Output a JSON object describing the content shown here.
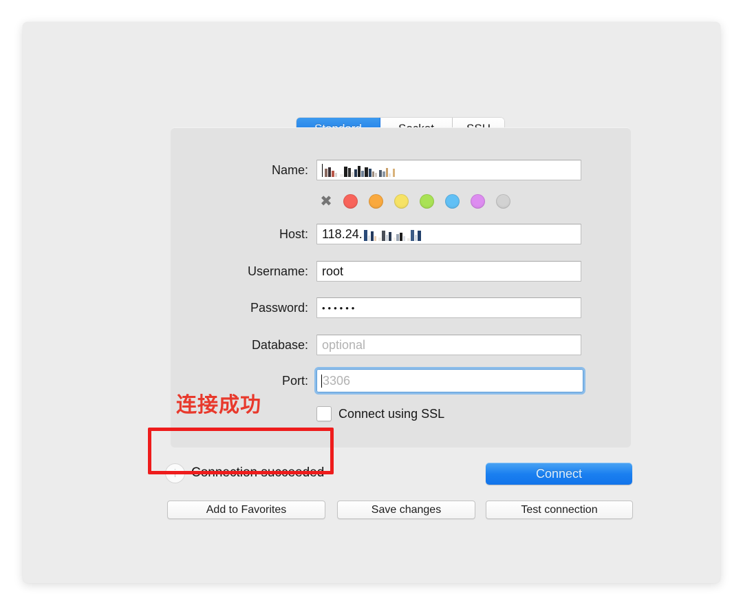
{
  "window": {
    "title": ""
  },
  "tabs": {
    "items": [
      {
        "label": "Standard",
        "active": true
      },
      {
        "label": "Socket",
        "active": false
      },
      {
        "label": "SSH",
        "active": false
      }
    ]
  },
  "form": {
    "fields": [
      {
        "label": "Name:",
        "value": "",
        "placeholder": "",
        "redacted": true,
        "focused": false
      },
      {
        "label": "Host:",
        "value": "118.24.",
        "placeholder": "",
        "redacted": true,
        "focused": false
      },
      {
        "label": "Username:",
        "value": "root",
        "placeholder": "",
        "redacted": false,
        "focused": false
      },
      {
        "label": "Password:",
        "value": "••••••",
        "placeholder": "",
        "redacted": false,
        "focused": false
      },
      {
        "label": "Database:",
        "value": "",
        "placeholder": "optional",
        "redacted": false,
        "focused": false
      },
      {
        "label": "Port:",
        "value": "",
        "placeholder": "3306",
        "redacted": false,
        "focused": true
      }
    ],
    "colors": {
      "none_label": "✖",
      "swatches": [
        "#f8645b",
        "#f9a93f",
        "#f6e265",
        "#a9e255",
        "#62c0f5",
        "#dd8df0",
        "#d2d2d2"
      ]
    },
    "ssl": {
      "label": "Connect using SSL",
      "checked": false
    }
  },
  "status": {
    "icon": "i",
    "text": "Connection succeeded"
  },
  "actions": {
    "connect": "Connect",
    "add_favorites": "Add to Favorites",
    "save_changes": "Save changes",
    "test_connection": "Test connection"
  },
  "annotations": {
    "chinese_note": "连接成功",
    "highlight_color": "#ee1c1c",
    "note_color": "#e8392c"
  }
}
